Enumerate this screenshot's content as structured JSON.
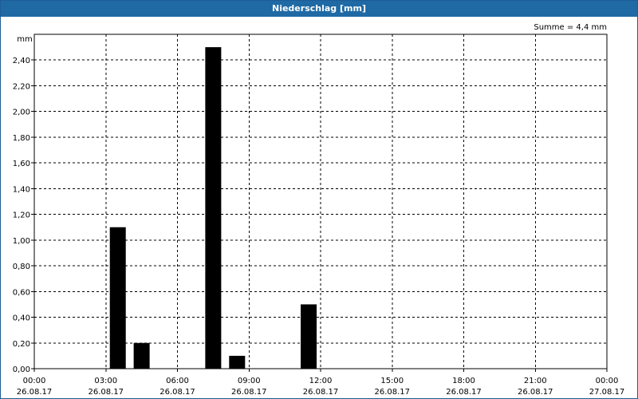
{
  "window": {
    "title": "Niederschlag [mm]"
  },
  "chart_data": {
    "type": "bar",
    "title": "Niederschlag [mm]",
    "ylabel": "mm",
    "ylim": [
      0,
      2.6
    ],
    "yticks": [
      0,
      0.2,
      0.4,
      0.6,
      0.8,
      1.0,
      1.2,
      1.4,
      1.6,
      1.8,
      2.0,
      2.2,
      2.4
    ],
    "ytick_labels": [
      "0,00",
      "0,20",
      "0,40",
      "0,60",
      "0,80",
      "1,00",
      "1,20",
      "1,40",
      "1,60",
      "1,80",
      "2,00",
      "2,20",
      "2,40"
    ],
    "xlim_hours": [
      0,
      24
    ],
    "x_ticks": [
      {
        "hour": 0,
        "time": "00:00",
        "date": "26.08.17"
      },
      {
        "hour": 3,
        "time": "03:00",
        "date": "26.08.17"
      },
      {
        "hour": 6,
        "time": "06:00",
        "date": "26.08.17"
      },
      {
        "hour": 9,
        "time": "09:00",
        "date": "26.08.17"
      },
      {
        "hour": 12,
        "time": "12:00",
        "date": "26.08.17"
      },
      {
        "hour": 15,
        "time": "15:00",
        "date": "26.08.17"
      },
      {
        "hour": 18,
        "time": "18:00",
        "date": "26.08.17"
      },
      {
        "hour": 21,
        "time": "21:00",
        "date": "26.08.17"
      },
      {
        "hour": 24,
        "time": "00:00",
        "date": "27.08.17"
      }
    ],
    "bars": [
      {
        "hour": 3.5,
        "value": 1.1
      },
      {
        "hour": 4.5,
        "value": 0.2
      },
      {
        "hour": 7.5,
        "value": 2.5
      },
      {
        "hour": 8.5,
        "value": 0.1
      },
      {
        "hour": 11.5,
        "value": 0.5
      }
    ],
    "annotation": "Summe = 4,4 mm",
    "grid": true,
    "bar_color": "#000000"
  }
}
